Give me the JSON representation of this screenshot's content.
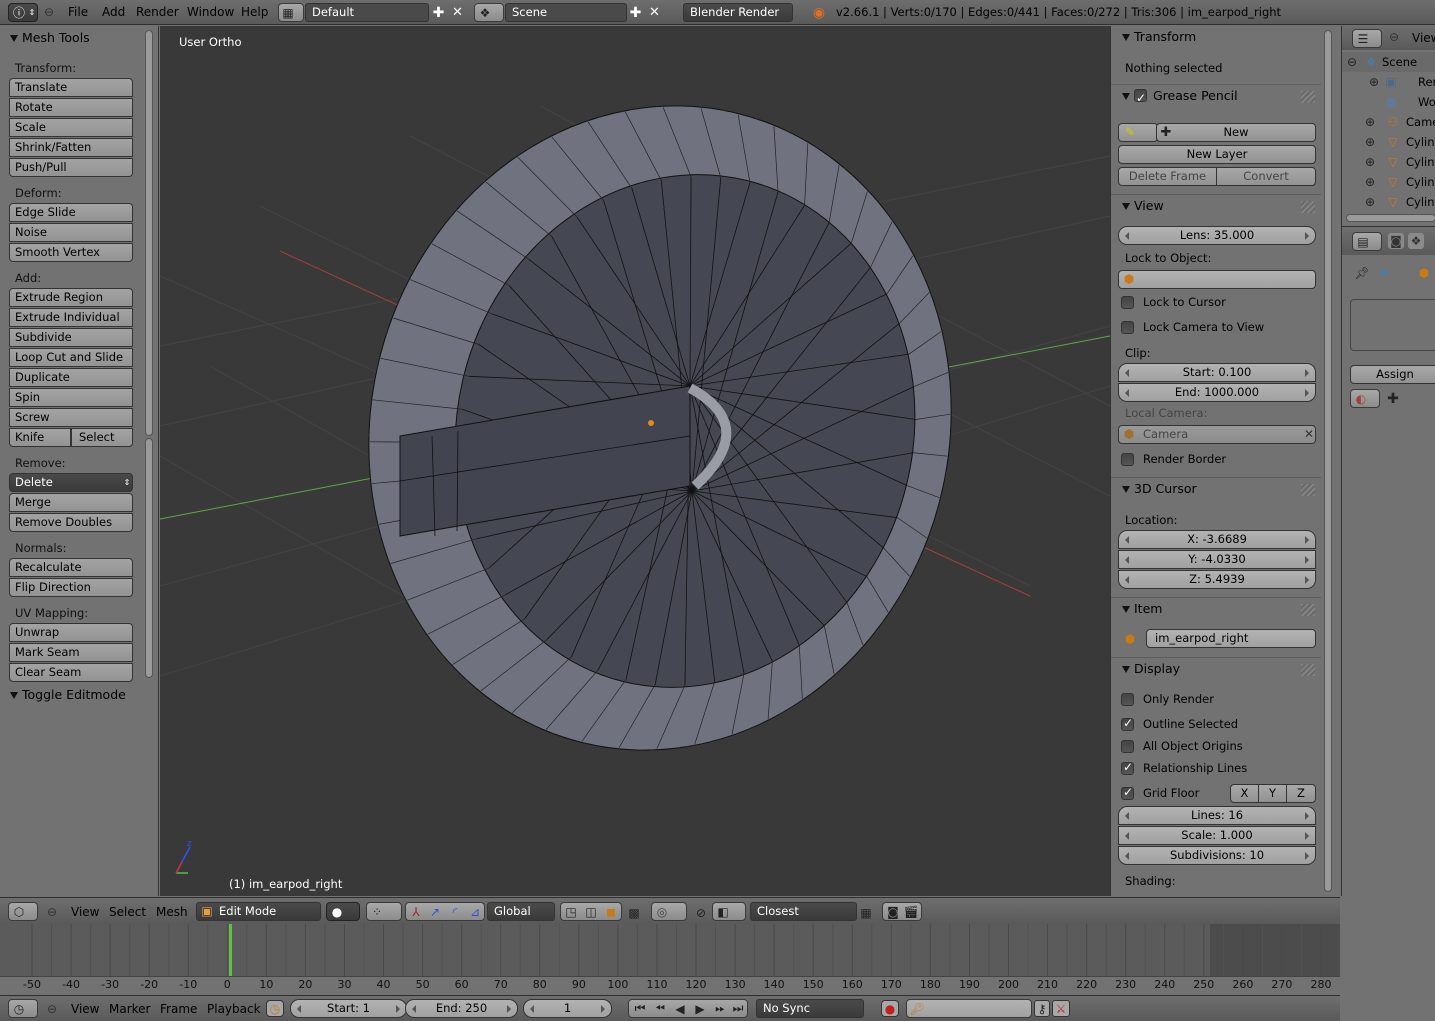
{
  "top": {
    "menus": [
      "File",
      "Add",
      "Render",
      "Window",
      "Help"
    ],
    "screen_layout": "Default",
    "scene": "Scene",
    "render_engine": "Blender Render",
    "stats": "v2.66.1 | Verts:0/170 | Edges:0/441 | Faces:0/272 | Tris:306 | im_earpod_right"
  },
  "mesh_tools": {
    "title": "Mesh Tools",
    "transform_label": "Transform:",
    "transform": [
      "Translate",
      "Rotate",
      "Scale",
      "Shrink/Fatten",
      "Push/Pull"
    ],
    "deform_label": "Deform:",
    "deform": [
      "Edge Slide",
      "Noise",
      "Smooth Vertex"
    ],
    "add_label": "Add:",
    "add": [
      "Extrude Region",
      "Extrude Individual",
      "Subdivide",
      "Loop Cut and Slide",
      "Duplicate",
      "Spin",
      "Screw"
    ],
    "knife": "Knife",
    "select": "Select",
    "remove_label": "Remove:",
    "delete": "Delete",
    "remove": [
      "Merge",
      "Remove Doubles"
    ],
    "normals_label": "Normals:",
    "normals": [
      "Recalculate",
      "Flip Direction"
    ],
    "uv_label": "UV Mapping:",
    "uv": [
      "Unwrap",
      "Mark Seam",
      "Clear Seam"
    ],
    "toggle_editmode": "Toggle Editmode"
  },
  "viewport": {
    "view_name": "User Ortho",
    "object_label": "(1) im_earpod_right"
  },
  "properties": {
    "transform_title": "Transform",
    "nothing_selected": "Nothing selected",
    "grease_pencil_title": "Grease Pencil",
    "gp_new": "New",
    "gp_new_layer": "New Layer",
    "gp_delete_frame": "Delete Frame",
    "gp_convert": "Convert",
    "view_title": "View",
    "lens": "Lens: 35.000",
    "lock_to_object": "Lock to Object:",
    "lock_to_cursor": "Lock to Cursor",
    "lock_camera": "Lock Camera to View",
    "clip": "Clip:",
    "clip_start": "Start: 0.100",
    "clip_end": "End: 1000.000",
    "local_camera": "Local Camera:",
    "camera": "Camera",
    "render_border": "Render Border",
    "cursor_title": "3D Cursor",
    "location": "Location:",
    "cx": "X: -3.6689",
    "cy": "Y: -4.0330",
    "cz": "Z: 5.4939",
    "item_title": "Item",
    "item_name": "im_earpod_right",
    "display_title": "Display",
    "only_render": "Only Render",
    "outline_selected": "Outline Selected",
    "all_origins": "All Object Origins",
    "relationship_lines": "Relationship Lines",
    "grid_floor": "Grid Floor",
    "axis_x": "X",
    "axis_y": "Y",
    "axis_z": "Z",
    "lines": "Lines: 16",
    "scale": "Scale: 1.000",
    "subdivisions": "Subdivisions: 10",
    "shading": "Shading:"
  },
  "outliner": {
    "view": "View",
    "items": [
      "Scene",
      "Render",
      "World",
      "Camer",
      "Cylind",
      "Cylind",
      "Cylind",
      "Cylind"
    ]
  },
  "props_editor": {
    "assign": "Assign"
  },
  "viewport_header": {
    "menus": [
      "View",
      "Select",
      "Mesh"
    ],
    "mode": "Edit Mode",
    "orientation": "Global",
    "snap": "Closest"
  },
  "timeline": {
    "ticks": [
      "-50",
      "-40",
      "-30",
      "-20",
      "-10",
      "0",
      "10",
      "20",
      "30",
      "40",
      "50",
      "60",
      "70",
      "80",
      "90",
      "100",
      "110",
      "120",
      "130",
      "140",
      "150",
      "160",
      "170",
      "180",
      "190",
      "200",
      "210",
      "220",
      "230",
      "240",
      "250",
      "260",
      "270",
      "280"
    ],
    "menus": [
      "View",
      "Marker",
      "Frame",
      "Playback"
    ],
    "start": "Start: 1",
    "end": "End: 250",
    "current": "1",
    "sync": "No Sync"
  }
}
